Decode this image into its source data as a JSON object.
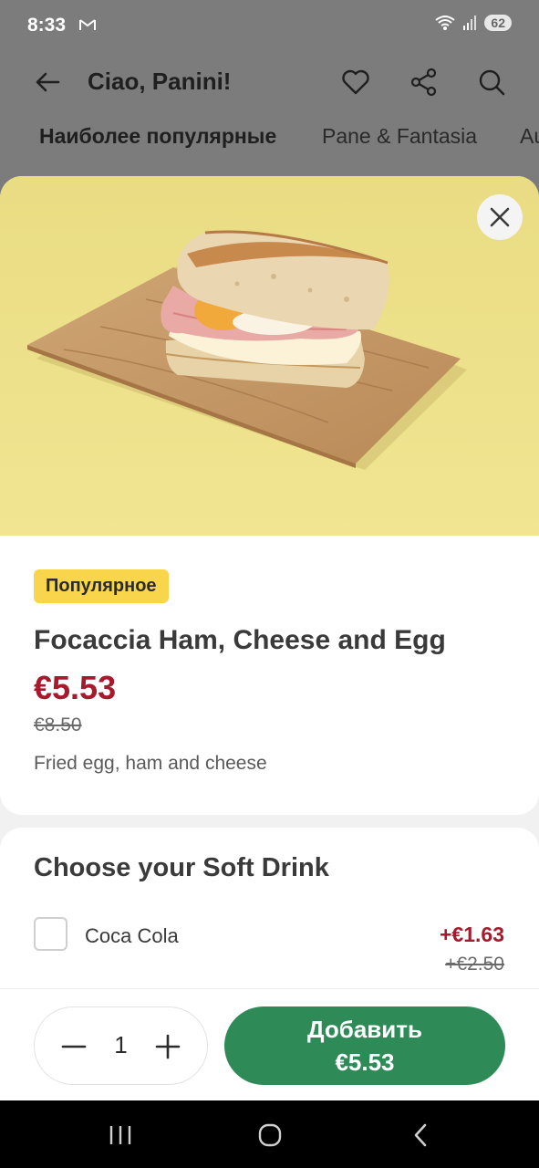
{
  "status": {
    "time": "8:33",
    "battery": "62"
  },
  "header": {
    "title": "Ciao, Panini!",
    "tabs": [
      "Наиболее популярные",
      "Pane & Fantasia",
      "Au"
    ]
  },
  "product": {
    "badge": "Популярное",
    "title": "Focaccia Ham, Cheese and Egg",
    "price": "€5.53",
    "old_price": "€8.50",
    "description": "Fried egg, ham and cheese"
  },
  "options": {
    "title": "Choose your Soft Drink",
    "items": [
      {
        "label": "Coca Cola",
        "price": "+€1.63",
        "old_price": "+€2.50"
      }
    ]
  },
  "cart": {
    "quantity": "1",
    "add_label": "Добавить",
    "add_price": "€5.53"
  },
  "colors": {
    "accent_green": "#2e8b57",
    "price_red": "#a51a2c",
    "badge_yellow": "#f8d54b"
  }
}
